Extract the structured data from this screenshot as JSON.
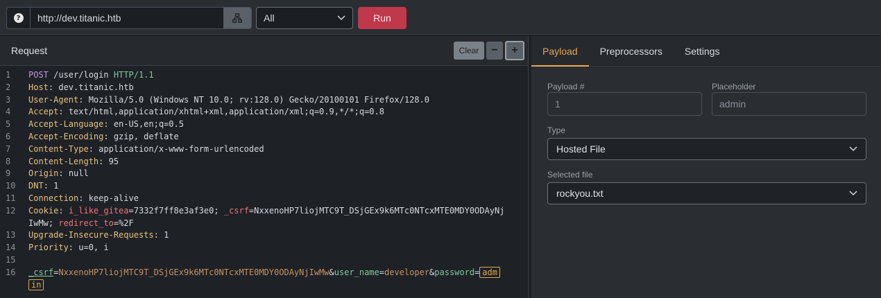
{
  "topbar": {
    "help_icon": "?",
    "url": "http://dev.titanic.htb",
    "filter": "All",
    "run_label": "Run"
  },
  "request": {
    "title": "Request",
    "clear_label": "Clear",
    "minus_label": "−",
    "plus_label": "+",
    "lines": {
      "n1": "1",
      "n2": "2",
      "n3": "3",
      "n4": "4",
      "n5": "5",
      "n6": "6",
      "n7": "7",
      "n8": "8",
      "n9": "9",
      "n10": "10",
      "n11": "11",
      "n12": "12",
      "n13": "13",
      "n14": "14",
      "n15": "15",
      "n16": "16",
      "method": "POST",
      "path": " /user/login ",
      "proto": "HTTP/1.1",
      "host_k": "Host",
      "host_v": "dev.titanic.htb",
      "ua_k": "User-Agent",
      "ua_v": "Mozilla/5.0 (Windows NT 10.0; rv:128.0) Gecko/20100101 Firefox/128.0",
      "accept_k": "Accept",
      "accept_v": "text/html,application/xhtml+xml,application/xml;q=0.9,*/*;q=0.8",
      "al_k": "Accept-Language",
      "al_v": "en-US,en;q=0.5",
      "ae_k": "Accept-Encoding",
      "ae_v": "gzip, deflate",
      "ct_k": "Content-Type",
      "ct_v": "application/x-www-form-urlencoded",
      "cl_k": "Content-Length",
      "cl_v": "95",
      "origin_k": "Origin",
      "origin_v": "null",
      "dnt_k": "DNT",
      "dnt_v": "1",
      "conn_k": "Connection",
      "conn_v": "keep-alive",
      "cookie_k": "Cookie",
      "c1_name": "i_like_gitea",
      "c1_val": "7332f7ff8e3af3e0",
      "c2_name": "_csrf",
      "c2_val": "NxxenoHP7liojMTC9T_DSjGEx9k6MTc0NTcxMTE0MDY0ODAyNj",
      "c2_val_cont": "IwMw",
      "c3_name": "redirect_to",
      "c3_val": "%2F",
      "uir_k": "Upgrade-Insecure-Requests",
      "uir_v": "1",
      "prio_k": "Priority",
      "prio_v": "u=0, i",
      "b_csrf_k": "_csrf",
      "b_csrf_v": "NxxenoHP7liojMTC9T_DSjGEx9k6MTc0NTcxMTE0MDY0ODAyNjIwMw",
      "b_user_k": "user_name",
      "b_user_v": "developer",
      "b_pass_k": "password",
      "b_pass_v1": "adm",
      "b_pass_v2": "in"
    }
  },
  "right": {
    "tabs": [
      "Payload",
      "Preprocessors",
      "Settings"
    ],
    "payload_num_label": "Payload #",
    "payload_num_value": "1",
    "placeholder_label": "Placeholder",
    "placeholder_value": "admin",
    "type_label": "Type",
    "type_value": "Hosted File",
    "file_label": "Selected file",
    "file_value": "rockyou.txt"
  },
  "colors": {
    "accent": "#e8a24e",
    "run": "#c0384b"
  }
}
